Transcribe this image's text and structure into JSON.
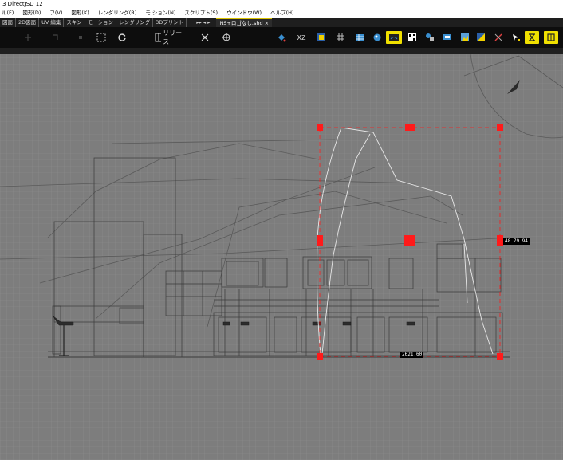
{
  "window": {
    "title": "3 DirectJSD 12"
  },
  "menu": [
    "ル(F)",
    "図形(D)",
    "フ(V)",
    "図形(K)",
    "レンダリング(R)",
    "モ ション(N)",
    "スクリプト(S)",
    "ウインドウ(W)",
    "ヘルプ(H)"
  ],
  "tabs": [
    "図面",
    "2D図面",
    "UV 編集",
    "スキン",
    "モーション",
    "レンダリング",
    "3Dプリント"
  ],
  "tab_nav": "▸▸  ◂ ▸",
  "document_tab": {
    "label": "NS+ロゴなし.shd",
    "close": "×"
  },
  "toolbar": {
    "left_icons": [
      "move-icon",
      "rotate-icon",
      "scale-icon",
      "select-rect-icon",
      "refresh-icon"
    ],
    "release_label": "リリース",
    "xz_label": "XZ"
  },
  "viewport": {
    "accent_color": "#ff1a1a",
    "grid_color": "#8c8c8c",
    "dimension_width": "2621.60",
    "dimension_height": "48.79.94"
  }
}
